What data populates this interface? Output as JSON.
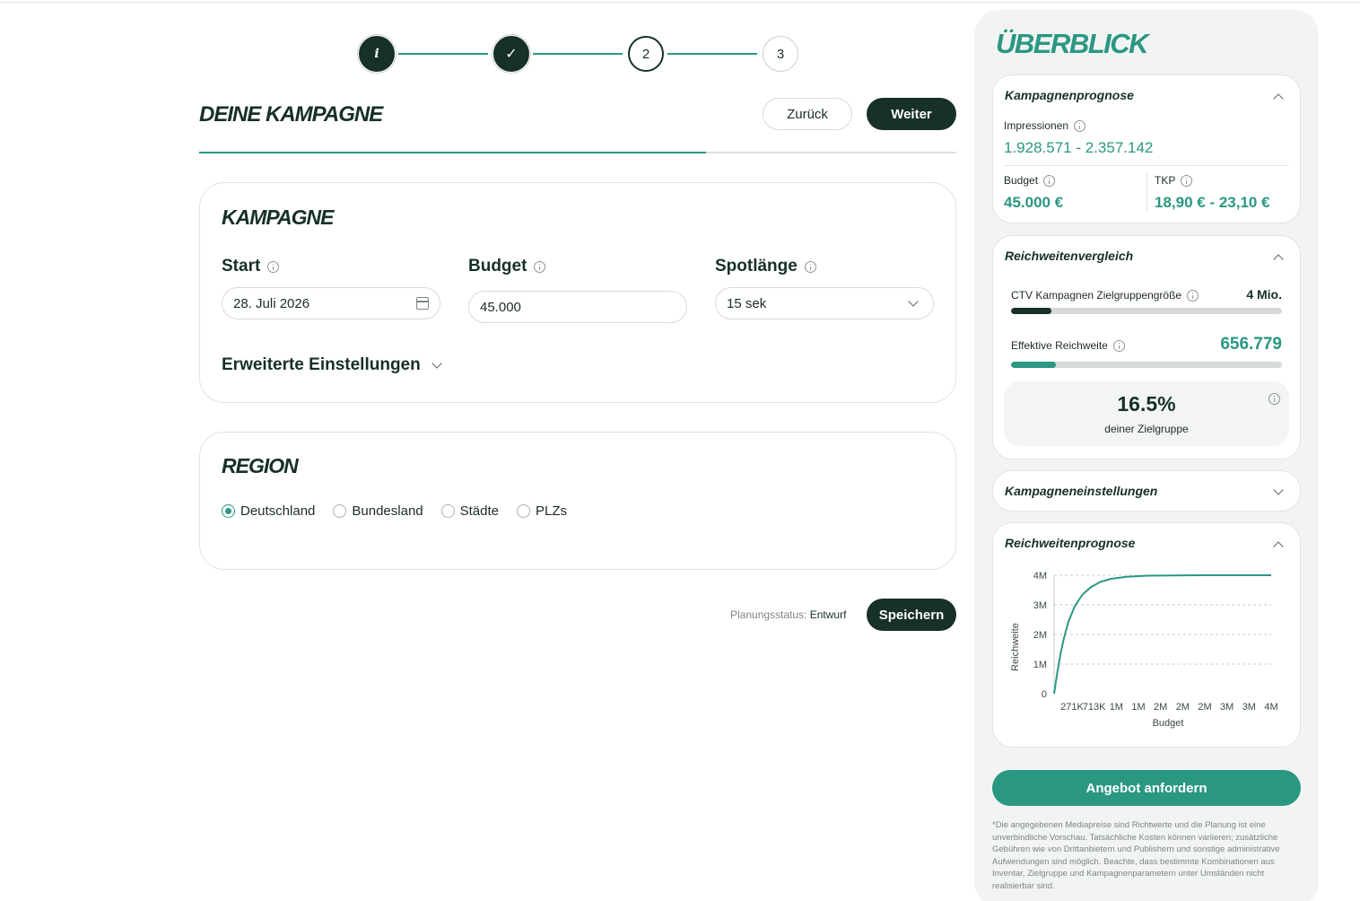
{
  "stepper": {
    "steps": [
      {
        "label": "i",
        "state": "info"
      },
      {
        "label": "✓",
        "state": "done"
      },
      {
        "label": "2",
        "state": "active"
      },
      {
        "label": "3",
        "state": "todo"
      }
    ]
  },
  "header": {
    "title": "DEINE KAMPAGNE",
    "back_label": "Zurück",
    "next_label": "Weiter",
    "progress_fraction": 0.67
  },
  "campaign": {
    "title": "KAMPAGNE",
    "start_label": "Start",
    "start_value": "28. Juli 2026",
    "budget_label": "Budget",
    "budget_value": "45.000",
    "spot_label": "Spotlänge",
    "spot_value": "15 sek",
    "advanced_label": "Erweiterte Einstellungen"
  },
  "region": {
    "title": "REGION",
    "options": [
      {
        "label": "Deutschland",
        "checked": true
      },
      {
        "label": "Bundesland",
        "checked": false
      },
      {
        "label": "Städte",
        "checked": false
      },
      {
        "label": "PLZs",
        "checked": false
      }
    ]
  },
  "footer": {
    "status_label": "Planungsstatus:",
    "status_value": "Entwurf",
    "save_label": "Speichern"
  },
  "sidebar": {
    "title": "ÜBERBLICK",
    "forecast": {
      "title": "Kampagnenprognose",
      "impressions_label": "Impressionen",
      "impressions_value": "1.928.571 - 2.357.142",
      "budget_label": "Budget",
      "budget_value": "45.000 €",
      "tkp_label": "TKP",
      "tkp_value": "18,90 € - 23,10 €"
    },
    "reach_compare": {
      "title": "Reichweitenvergleich",
      "target_label": "CTV Kampagnen Zielgruppengröße",
      "target_value": "4 Mio.",
      "target_fraction": 0.15,
      "reach_label": "Effektive Reichweite",
      "reach_value": "656.779",
      "reach_fraction": 0.165,
      "percent_value": "16.5%",
      "percent_sub": "deiner Zielgruppe"
    },
    "settings": {
      "title": "Kampagneneinstellungen"
    },
    "reach_forecast": {
      "title": "Reichweitenprognose"
    },
    "offer_label": "Angebot anfordern",
    "disclaimer": "*Die angegebenen Mediapreise sind Richtwerte und die Planung ist eine unverbindliche Vorschau. Tatsächliche Kosten können variieren; zusätzliche Gebühren wie von Drittanbietern und Publishern und sonstige administrative Aufwendungen sind möglich. Beachte, dass bestimmte Kombinationen aus Inventar, Zielgruppe und Kampagnenparametern unter Umständen nicht realisierbar sind.",
    "colors": {
      "accent": "#2a9782",
      "dark": "#173028",
      "bar_dark": "#173028"
    }
  },
  "chart_data": {
    "type": "line",
    "xlabel": "Budget",
    "ylabel": "Reichweite",
    "x_tick_labels": [
      "271K",
      "713K",
      "1M",
      "1M",
      "2M",
      "2M",
      "2M",
      "3M",
      "3M",
      "4M"
    ],
    "y_tick_labels": [
      "0",
      "1M",
      "2M",
      "3M",
      "4M"
    ],
    "ylim": [
      0,
      4000000
    ],
    "grid": true,
    "series": [
      {
        "x": [
          0,
          60000,
          120000,
          180000,
          271000,
          400000,
          550000,
          713000,
          900000,
          1100000,
          1400000,
          1800000,
          2300000,
          2800000,
          3300000,
          3800000,
          4200000
        ],
        "y": [
          0,
          700000,
          1300000,
          1800000,
          2400000,
          2950000,
          3350000,
          3600000,
          3780000,
          3880000,
          3950000,
          3985000,
          3995000,
          4000000,
          4000000,
          4000000,
          4000000
        ]
      }
    ]
  }
}
